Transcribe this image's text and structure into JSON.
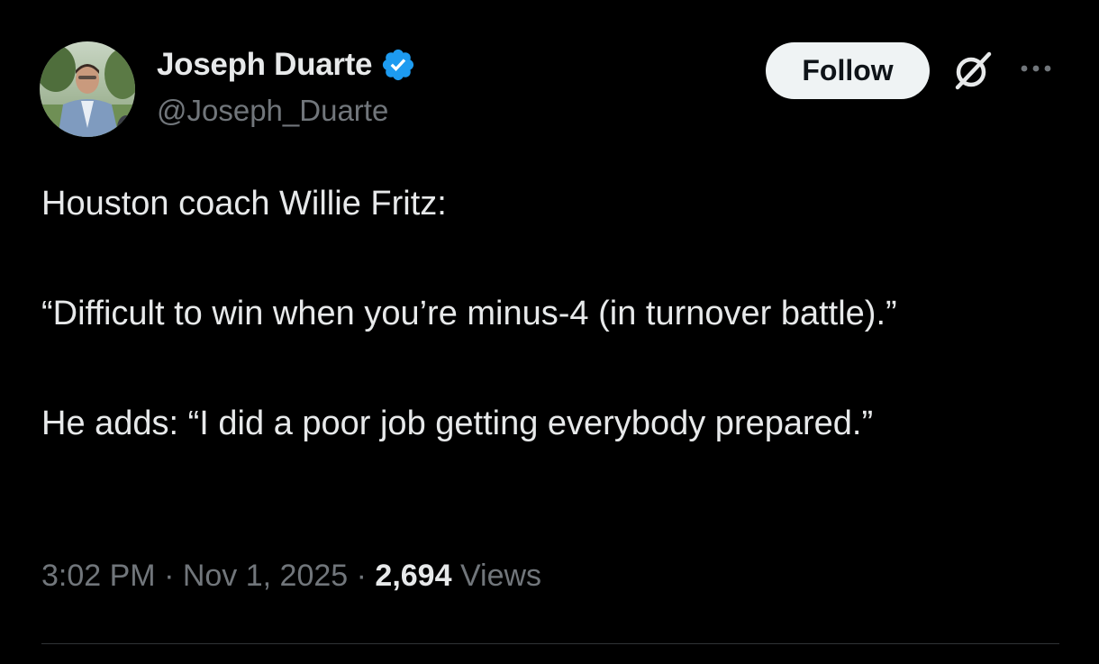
{
  "author": {
    "display_name": "Joseph Duarte",
    "handle": "@Joseph_Duarte",
    "verified": true
  },
  "actions": {
    "follow_label": "Follow",
    "grok_icon": "grok-icon",
    "more_icon": "more-dots-icon"
  },
  "tweet": {
    "line1": "Houston coach Willie Fritz:",
    "line2": "“Difficult to win when you’re minus-4 (in turnover battle).”",
    "line3": "He adds: “I did a poor job getting everybody prepared.”"
  },
  "meta": {
    "time": "3:02 PM",
    "separator": " · ",
    "date": "Nov 1, 2025",
    "views_count": "2,694",
    "views_label": " Views"
  },
  "colors": {
    "background": "#000000",
    "text_primary": "#e7e9ea",
    "text_secondary": "#71767b",
    "verified_blue": "#1d9bf0",
    "follow_bg": "#eff3f4",
    "divider": "#2f3336"
  }
}
